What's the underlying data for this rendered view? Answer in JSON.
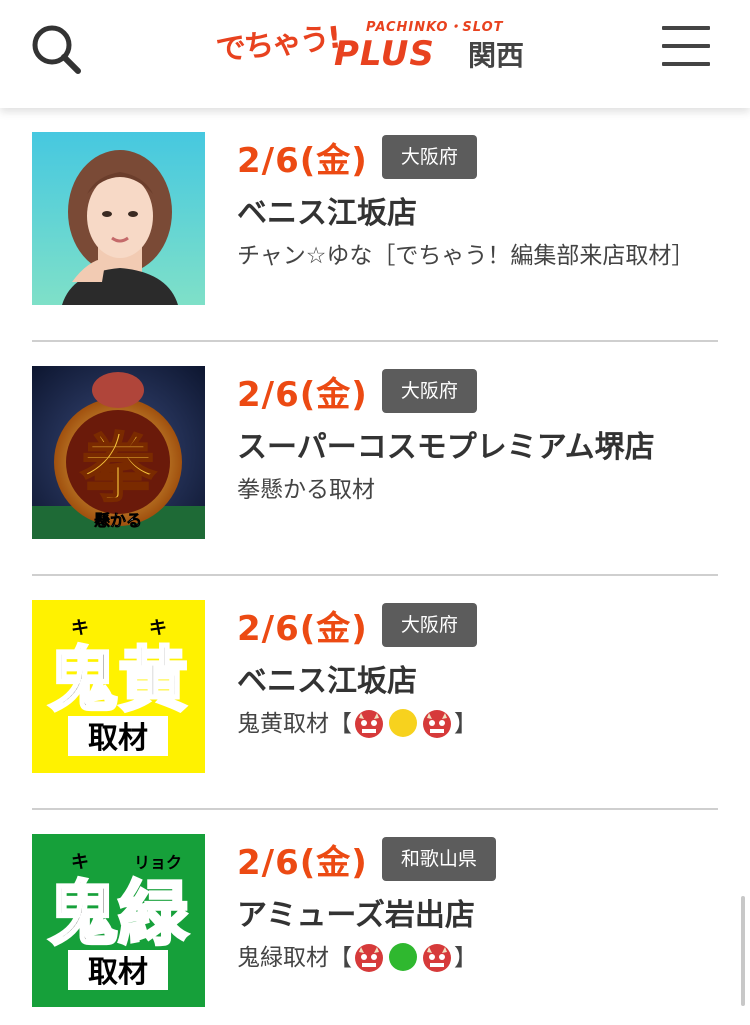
{
  "header": {
    "logo_script": "でちゃう!",
    "logo_tag": "PACHINKO・SLOT",
    "logo_main": "PLUS",
    "logo_region": "関西",
    "search_icon": "search-icon",
    "menu_icon": "hamburger-menu-icon"
  },
  "colors": {
    "accent": "#ec4a13",
    "badge_bg": "#5c5c5c",
    "divider": "#cfcfcf"
  },
  "items": [
    {
      "date": "2/6(金)",
      "prefecture": "大阪府",
      "store": "ベニス江坂店",
      "desc": "チャン☆ゆな［でちゃう！編集部来店取材］",
      "thumb": "woman-portrait-thumbnail"
    },
    {
      "date": "2/6(金)",
      "prefecture": "大阪府",
      "store": "スーパーコスモプレミアム堺店",
      "desc": "拳懸かる取材",
      "thumb": "fist-event-thumbnail",
      "thumb_big": "拳",
      "thumb_small": "懸かる"
    },
    {
      "date": "2/6(金)",
      "prefecture": "大阪府",
      "store": "ベニス江坂店",
      "desc_prefix": "鬼黄取材【",
      "desc_suffix": "】",
      "emojis": [
        "oni-emoji",
        "yellow-circle-emoji",
        "oni-emoji"
      ],
      "thumb": "oni-yellow-event-thumbnail",
      "thumb_ruby_left": "キ",
      "thumb_ruby_right": "キ",
      "thumb_big": "鬼黄",
      "thumb_small": "取材"
    },
    {
      "date": "2/6(金)",
      "prefecture": "和歌山県",
      "store": "アミューズ岩出店",
      "desc_prefix": "鬼緑取材【",
      "desc_suffix": "】",
      "emojis": [
        "oni-emoji",
        "green-circle-emoji",
        "oni-emoji"
      ],
      "thumb": "oni-green-event-thumbnail",
      "thumb_ruby_left": "キ",
      "thumb_ruby_right": "リョク",
      "thumb_big": "鬼緑",
      "thumb_small": "取材"
    }
  ]
}
